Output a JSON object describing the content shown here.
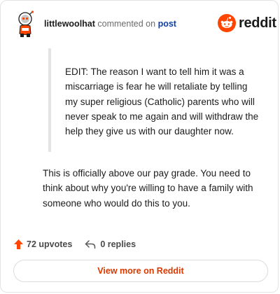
{
  "comment": {
    "author": "littlewoolhat",
    "verb": "commented on",
    "post_link": "post",
    "brand": "reddit",
    "quote": "EDIT: The reason I want to tell him it was a miscarriage is fear he will retaliate by telling my super religious (Catholic) parents who will never speak to me again and will withdraw the help they give us with our daughter now.",
    "body": "This is officially above our pay grade. You need to think about why you're willing to have a family with someone who would do this to you."
  },
  "actions": {
    "upvotes": "72 upvotes",
    "replies": "0 replies"
  },
  "view_more": "View more on Reddit",
  "colors": {
    "accent": "#d93a00",
    "brand_orange": "#ff4500",
    "link": "#0d3fa6",
    "quote_border": "#e4e4e4"
  },
  "icons": {
    "avatar": "snoo-avatar-icon",
    "brand": "reddit-logo-icon",
    "upvote": "upvote-arrow-icon",
    "reply": "reply-arrow-icon"
  }
}
